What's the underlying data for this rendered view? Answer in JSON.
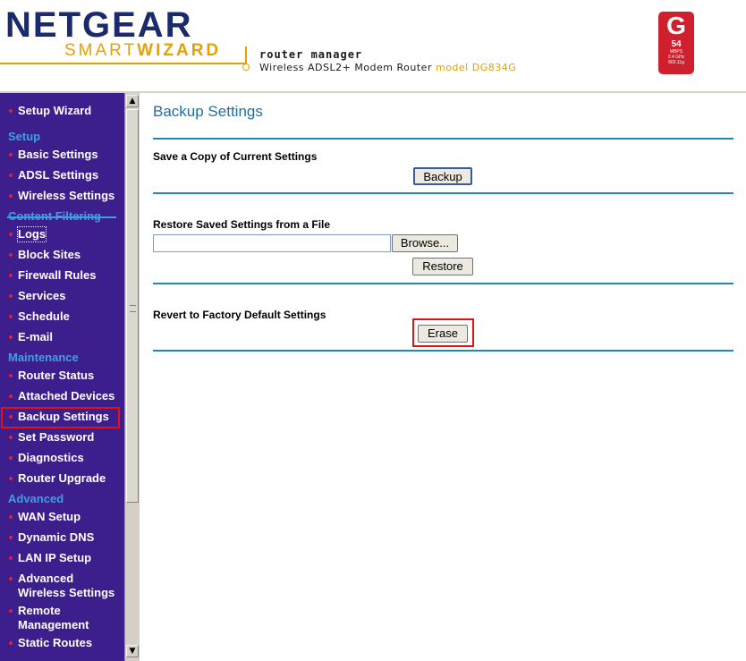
{
  "header": {
    "brand": "NETGEAR",
    "smart": "SMART",
    "wizard": "WIZARD",
    "title": "router manager",
    "subtitle": "Wireless ADSL2+ Modem Router",
    "model": "model DG834G",
    "badge_letter": "G",
    "badge_speed": "54",
    "badge_unit": "MBPS",
    "badge_freq": "2.4 GHz",
    "badge_std": "802.11g"
  },
  "sidebar": {
    "top_item": "Setup Wizard",
    "sections": [
      {
        "title": "Setup",
        "items": [
          "Basic Settings",
          "ADSL Settings",
          "Wireless Settings"
        ]
      },
      {
        "title": "Content Filtering",
        "items": [
          "Logs",
          "Block Sites",
          "Firewall Rules",
          "Services",
          "Schedule",
          "E-mail"
        ]
      },
      {
        "title": "Maintenance",
        "items": [
          "Router Status",
          "Attached Devices",
          "Backup Settings",
          "Set Password",
          "Diagnostics",
          "Router Upgrade"
        ]
      },
      {
        "title": "Advanced",
        "items": [
          "WAN Setup",
          "Dynamic DNS",
          "LAN IP Setup",
          "Advanced Wireless Settings",
          "Remote Management",
          "Static Routes"
        ]
      }
    ],
    "active_item": "Backup Settings",
    "accent_color": "#3fa0e0",
    "background_color": "#3c1e8c"
  },
  "main": {
    "page_title": "Backup Settings",
    "backup_label": "Save a Copy of Current Settings",
    "backup_button": "Backup",
    "restore_label": "Restore Saved Settings from a File",
    "browse_button": "Browse...",
    "restore_button": "Restore",
    "file_value": "",
    "factory_label": "Revert to Factory Default Settings",
    "erase_button": "Erase"
  }
}
